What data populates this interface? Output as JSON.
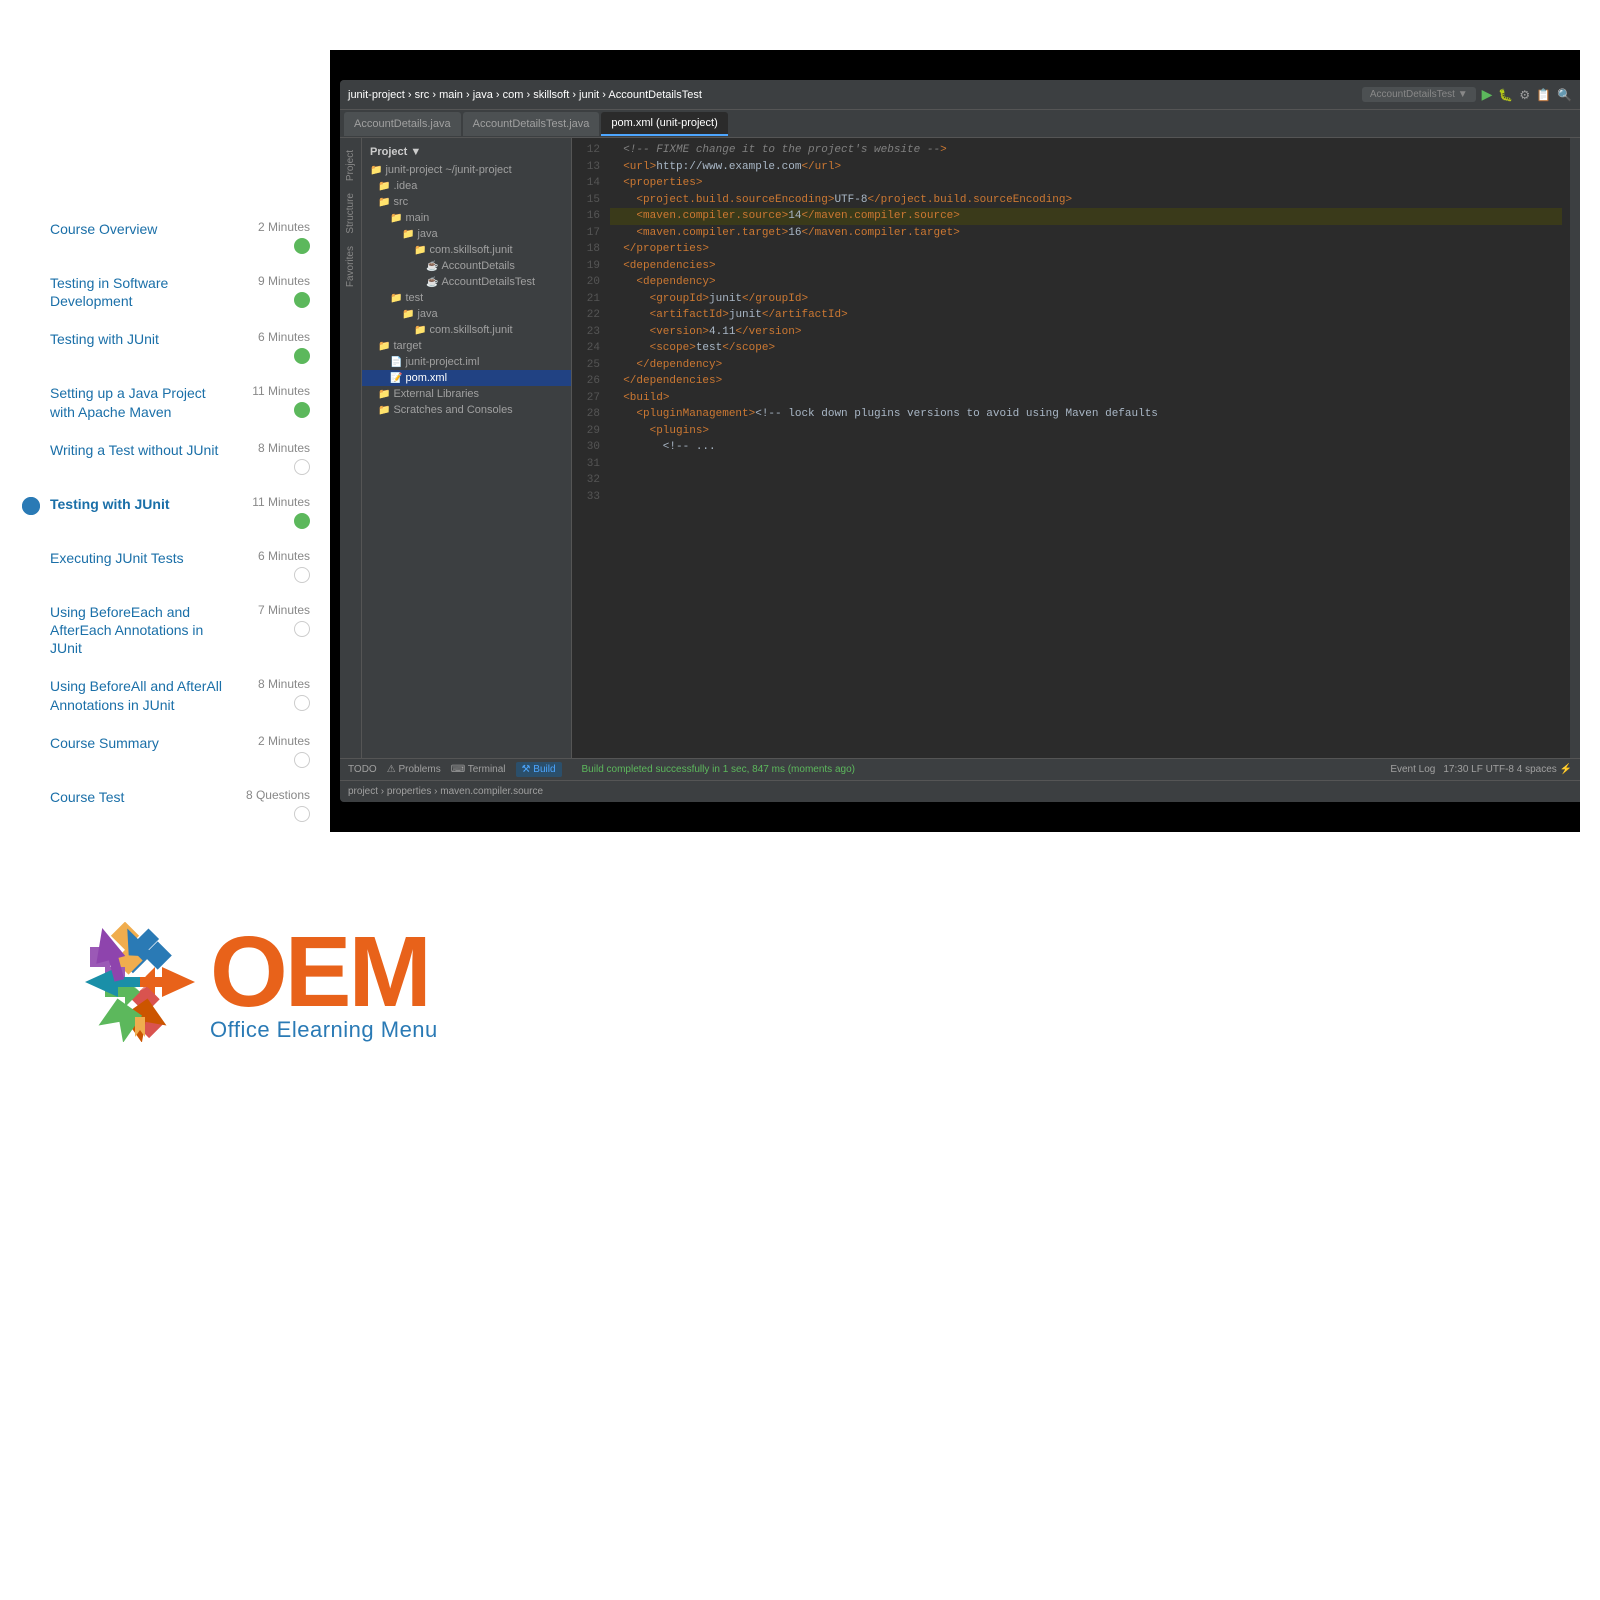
{
  "sidebar": {
    "items": [
      {
        "label": "Course Overview",
        "duration": "2 Minutes",
        "dot": "green",
        "active": false,
        "current": false
      },
      {
        "label": "Testing in Software Development",
        "duration": "9 Minutes",
        "dot": "green",
        "active": false,
        "current": false
      },
      {
        "label": "Testing with JUnit",
        "duration": "6 Minutes",
        "dot": "green",
        "active": false,
        "current": false
      },
      {
        "label": "Setting up a Java Project with Apache Maven",
        "duration": "11 Minutes",
        "dot": "green",
        "active": false,
        "current": false
      },
      {
        "label": "Writing a Test without JUnit",
        "duration": "8 Minutes",
        "dot": "empty",
        "active": false,
        "current": false
      },
      {
        "label": "Testing with JUnit",
        "duration": "11 Minutes",
        "dot": "green",
        "active": true,
        "current": true
      },
      {
        "label": "Executing JUnit Tests",
        "duration": "6 Minutes",
        "dot": "empty",
        "active": false,
        "current": false
      },
      {
        "label": "Using BeforeEach and AfterEach Annotations in JUnit",
        "duration": "7 Minutes",
        "dot": "empty",
        "active": false,
        "current": false
      },
      {
        "label": "Using BeforeAll and AfterAll Annotations in JUnit",
        "duration": "8 Minutes",
        "dot": "empty",
        "active": false,
        "current": false
      },
      {
        "label": "Course Summary",
        "duration": "2 Minutes",
        "dot": "empty",
        "active": false,
        "current": false
      },
      {
        "label": "Course Test",
        "duration": "8 Questions",
        "dot": "empty",
        "active": false,
        "current": false
      }
    ]
  },
  "ide": {
    "topbar": {
      "breadcrumb": "junit-project › src › main › java › com › skillsoft › junit › AccountDetailsTest",
      "tabs": [
        {
          "label": "AccountDetails.java",
          "active": false
        },
        {
          "label": "AccountDetailsTest.java",
          "active": false
        },
        {
          "label": "pom.xml (unit-project)",
          "active": true
        }
      ]
    },
    "project_tree": {
      "title": "Project ▼",
      "items": [
        {
          "label": "junit-project ~/junit-project",
          "indent": 0,
          "type": "folder"
        },
        {
          "label": ".idea",
          "indent": 1,
          "type": "folder"
        },
        {
          "label": "src",
          "indent": 1,
          "type": "folder"
        },
        {
          "label": "main",
          "indent": 2,
          "type": "folder"
        },
        {
          "label": "java",
          "indent": 3,
          "type": "folder"
        },
        {
          "label": "com.skillsoft.junit",
          "indent": 4,
          "type": "folder"
        },
        {
          "label": "AccountDetails",
          "indent": 5,
          "type": "java"
        },
        {
          "label": "AccountDetailsTest",
          "indent": 5,
          "type": "java"
        },
        {
          "label": "test",
          "indent": 2,
          "type": "folder"
        },
        {
          "label": "java",
          "indent": 3,
          "type": "folder"
        },
        {
          "label": "com.skillsoft.junit",
          "indent": 4,
          "type": "folder"
        },
        {
          "label": "target",
          "indent": 1,
          "type": "folder"
        },
        {
          "label": "junit-project.iml",
          "indent": 2,
          "type": "file"
        },
        {
          "label": "pom.xml",
          "indent": 2,
          "type": "xml",
          "selected": true
        },
        {
          "label": "External Libraries",
          "indent": 1,
          "type": "folder"
        },
        {
          "label": "Scratches and Consoles",
          "indent": 1,
          "type": "folder"
        }
      ]
    },
    "code_lines": [
      {
        "num": "12",
        "content": "  <!-- FIXME change it to the project's website -->",
        "type": "comment"
      },
      {
        "num": "13",
        "content": "  <url>http://www.example.com</url>",
        "type": "normal"
      },
      {
        "num": "14",
        "content": "",
        "type": "normal"
      },
      {
        "num": "15",
        "content": "  <properties>",
        "type": "normal"
      },
      {
        "num": "16",
        "content": "    <project.build.sourceEncoding>UTF-8</project.build.sourceEncoding>",
        "type": "normal"
      },
      {
        "num": "17",
        "content": "    <maven.compiler.source>14</maven.compiler.source>",
        "type": "highlighted"
      },
      {
        "num": "18",
        "content": "    <maven.compiler.target>16</maven.compiler.target>",
        "type": "normal"
      },
      {
        "num": "19",
        "content": "  </properties>",
        "type": "normal"
      },
      {
        "num": "20",
        "content": "",
        "type": "normal"
      },
      {
        "num": "21",
        "content": "  <dependencies>",
        "type": "normal"
      },
      {
        "num": "22",
        "content": "    <dependency>",
        "type": "normal"
      },
      {
        "num": "23",
        "content": "      <groupId>junit</groupId>",
        "type": "normal"
      },
      {
        "num": "24",
        "content": "      <artifactId>junit</artifactId>",
        "type": "normal"
      },
      {
        "num": "25",
        "content": "      <version>4.11</version>",
        "type": "boxed"
      },
      {
        "num": "26",
        "content": "      <scope>test</scope>",
        "type": "normal"
      },
      {
        "num": "27",
        "content": "    </dependency>",
        "type": "normal"
      },
      {
        "num": "28",
        "content": "  </dependencies>",
        "type": "normal"
      },
      {
        "num": "29",
        "content": "",
        "type": "normal"
      },
      {
        "num": "30",
        "content": "  <build>",
        "type": "normal"
      },
      {
        "num": "31",
        "content": "    <pluginManagement><!-- lock down plugins versions to avoid using Maven defaults",
        "type": "normal"
      },
      {
        "num": "32",
        "content": "      <plugins>",
        "type": "normal"
      },
      {
        "num": "33",
        "content": "        <!-- ...",
        "type": "normal"
      }
    ],
    "statusbar": {
      "tabs": [
        "TODO",
        "Problems",
        "Terminal",
        "Build"
      ],
      "active_tab": "Build",
      "build_status": "Build completed successfully in 1 sec, 847 ms (moments ago)",
      "right_info": "17:30  LF  UTF-8  4 spaces  ⚡"
    },
    "breadcrumb_bottom": "project › properties › maven.compiler.source"
  },
  "logo": {
    "text": "OEM",
    "subtitle": "Office Elearning Menu"
  }
}
